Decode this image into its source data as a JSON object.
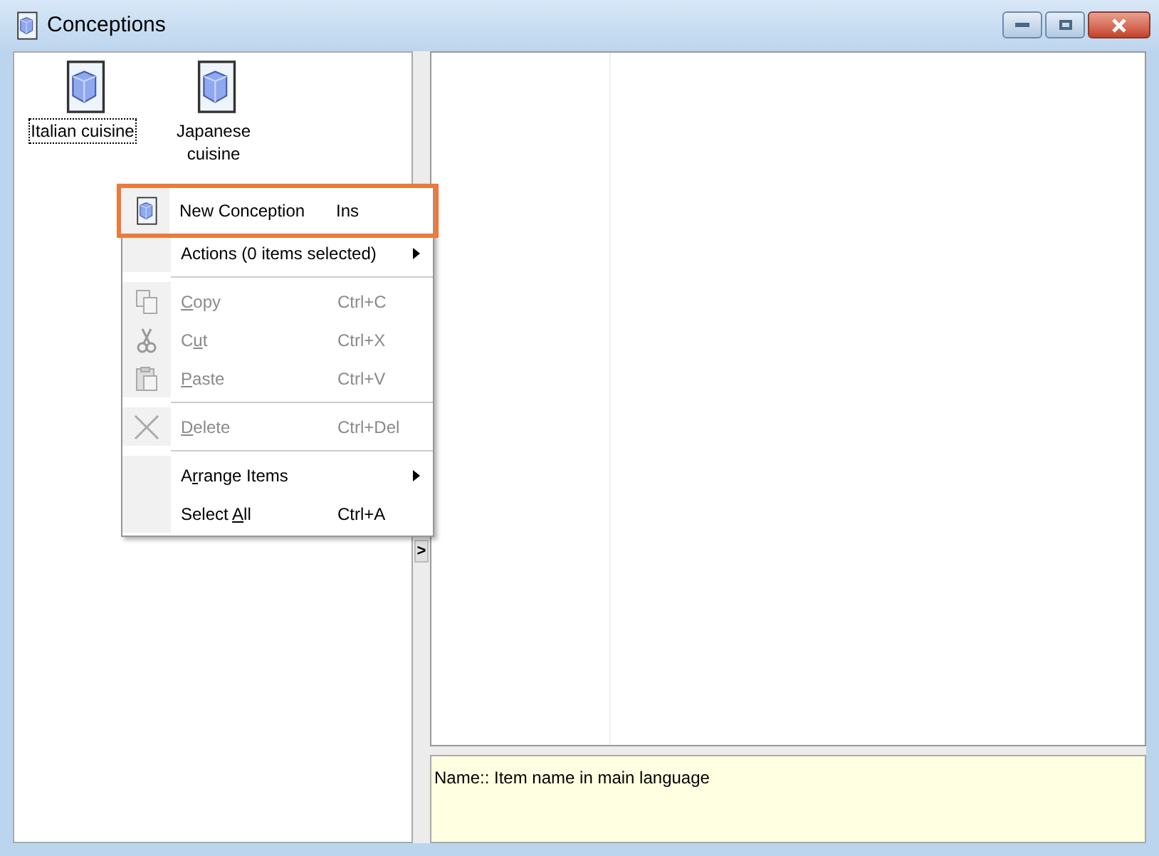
{
  "window": {
    "title": "Conceptions"
  },
  "items": [
    {
      "label": "Italian cuisine",
      "selected": true
    },
    {
      "label": "Japanese cuisine",
      "selected": false
    }
  ],
  "context_menu": [
    {
      "kind": "new",
      "label": {
        "before": "New Conception"
      },
      "shortcut": "Ins",
      "selected": true,
      "disabled": false,
      "submenu": false
    },
    {
      "kind": "plain",
      "label": {
        "before": "Actions (0 items selected)"
      },
      "selected": false,
      "disabled": false,
      "submenu": true
    },
    {
      "kind": "separator"
    },
    {
      "kind": "copy",
      "label": {
        "accel": "C",
        "after": "opy"
      },
      "shortcut": "Ctrl+C",
      "selected": false,
      "disabled": true,
      "submenu": false
    },
    {
      "kind": "cut",
      "label": {
        "before": "C",
        "accel": "u",
        "after": "t"
      },
      "shortcut": "Ctrl+X",
      "selected": false,
      "disabled": true,
      "submenu": false
    },
    {
      "kind": "paste",
      "label": {
        "accel": "P",
        "after": "aste"
      },
      "shortcut": "Ctrl+V",
      "selected": false,
      "disabled": true,
      "submenu": false
    },
    {
      "kind": "separator"
    },
    {
      "kind": "delete",
      "label": {
        "accel": "D",
        "after": "elete"
      },
      "shortcut": "Ctrl+Del",
      "selected": false,
      "disabled": true,
      "submenu": false
    },
    {
      "kind": "separator"
    },
    {
      "kind": "plain",
      "label": {
        "before": "A",
        "accel": "r",
        "after": "range Items"
      },
      "selected": false,
      "disabled": false,
      "submenu": true
    },
    {
      "kind": "plain",
      "label": {
        "before": "Select ",
        "accel": "A",
        "after": "ll"
      },
      "shortcut": "Ctrl+A",
      "selected": false,
      "disabled": false,
      "submenu": false
    }
  ],
  "splitter": {
    "button": ">"
  },
  "info_panel": {
    "text": "Name:: Item name in main language"
  }
}
